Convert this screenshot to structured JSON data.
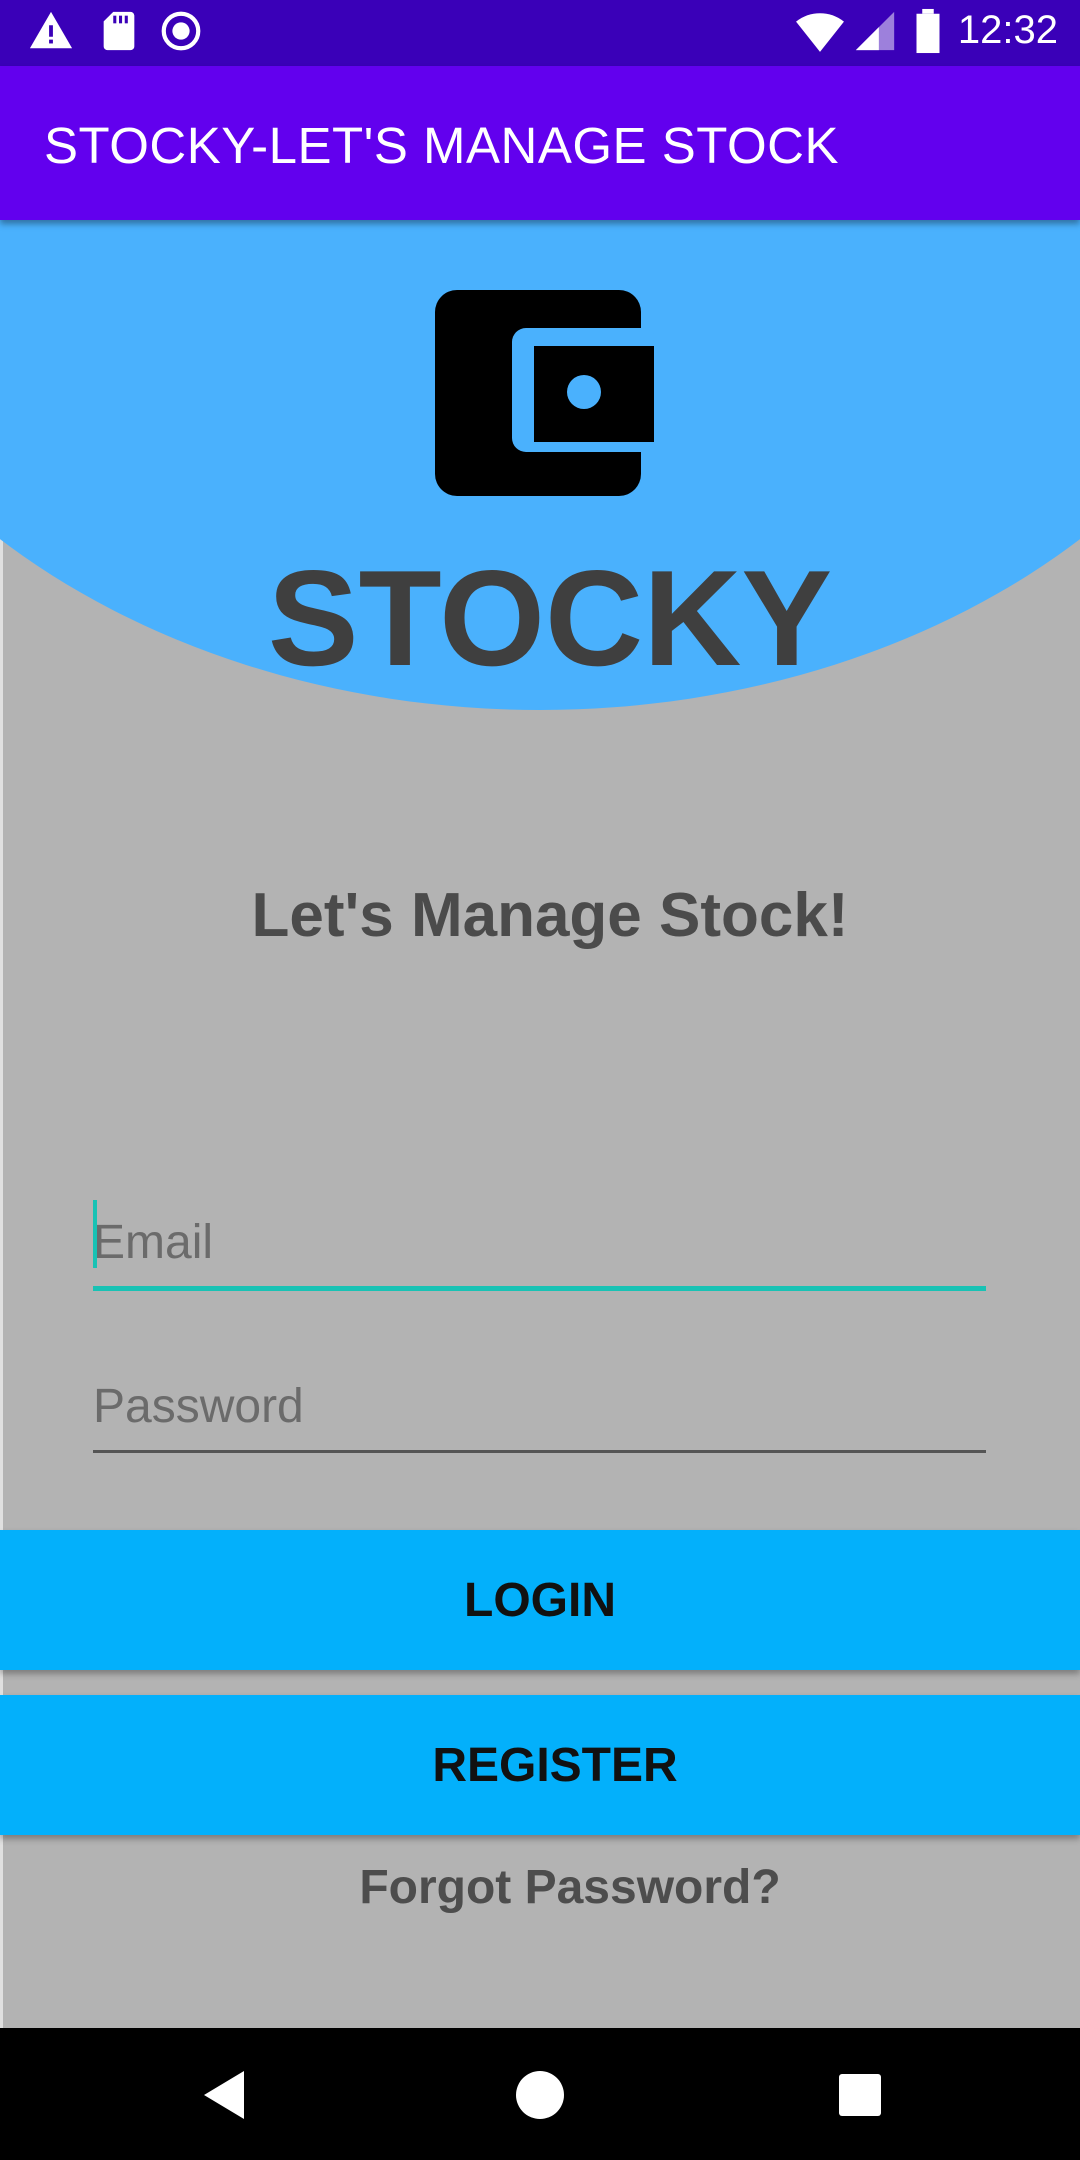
{
  "status_bar": {
    "time": "12:32",
    "left_icons": [
      "warning-icon",
      "sd-card-icon",
      "record-icon"
    ],
    "right_icons": [
      "wifi-icon",
      "signal-icon",
      "battery-icon"
    ]
  },
  "app_bar": {
    "title": "STOCKY-LET'S MANAGE STOCK"
  },
  "header": {
    "logo_icon": "wallet-icon",
    "brand": "STOCKY"
  },
  "tagline": "Let's Manage Stock!",
  "form": {
    "email_placeholder": "Email",
    "email_value": "",
    "password_placeholder": "Password",
    "password_value": ""
  },
  "buttons": {
    "login": "LOGIN",
    "register": "REGISTER"
  },
  "forgot_password": "Forgot Password?",
  "nav_bar": {
    "icons": [
      "back-icon",
      "home-icon",
      "recents-icon"
    ]
  },
  "colors": {
    "status_bar": "#3a00b8",
    "app_bar": "#6200ee",
    "header_curve": "#4ab1fd",
    "background": "#b3b3b3",
    "button": "#03b0fb",
    "field_focus": "#18c2b4"
  }
}
